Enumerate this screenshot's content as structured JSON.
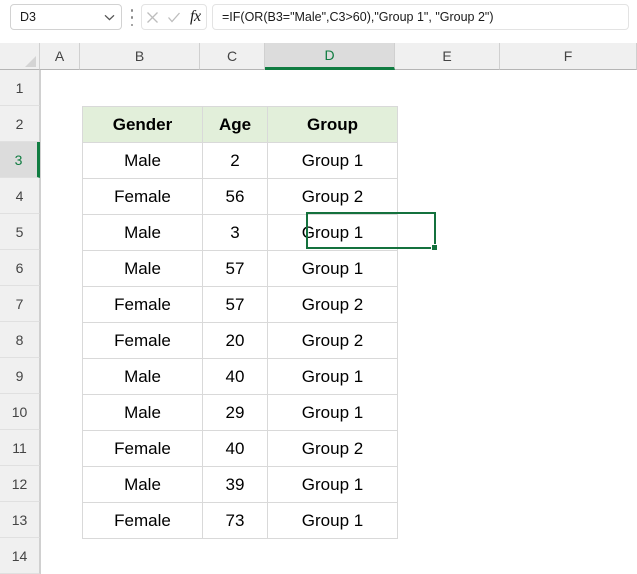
{
  "formula_bar": {
    "name_box_value": "D3",
    "name_box_icon": "chevron-down-icon",
    "cancel_icon": "x-icon",
    "confirm_icon": "check-icon",
    "function_icon": "fx-icon",
    "function_label": "fx",
    "formula": "=IF(OR(B3=\"Male\",C3>60),\"Group 1\", \"Group 2\")"
  },
  "grid": {
    "column_headers": [
      "A",
      "B",
      "C",
      "D",
      "E",
      "F"
    ],
    "active_column": "D",
    "row_headers": [
      "1",
      "2",
      "3",
      "4",
      "5",
      "6",
      "7",
      "8",
      "9",
      "10",
      "11",
      "12",
      "13",
      "14"
    ],
    "active_row": "3",
    "select_all_icon": "select-all-triangle-icon"
  },
  "table": {
    "headers": [
      "Gender",
      "Age",
      "Group"
    ],
    "header_fill": "#e2efda",
    "rows": [
      {
        "gender": "Male",
        "age": "2",
        "group": "Group 1"
      },
      {
        "gender": "Female",
        "age": "56",
        "group": "Group 2"
      },
      {
        "gender": "Male",
        "age": "3",
        "group": "Group 1"
      },
      {
        "gender": "Male",
        "age": "57",
        "group": "Group 1"
      },
      {
        "gender": "Female",
        "age": "57",
        "group": "Group 2"
      },
      {
        "gender": "Female",
        "age": "20",
        "group": "Group 2"
      },
      {
        "gender": "Male",
        "age": "40",
        "group": "Group 1"
      },
      {
        "gender": "Male",
        "age": "29",
        "group": "Group 1"
      },
      {
        "gender": "Female",
        "age": "40",
        "group": "Group 2"
      },
      {
        "gender": "Male",
        "age": "39",
        "group": "Group 1"
      },
      {
        "gender": "Female",
        "age": "73",
        "group": "Group 1"
      }
    ]
  },
  "selection": {
    "cell": "D3",
    "accent_color": "#14713d"
  }
}
